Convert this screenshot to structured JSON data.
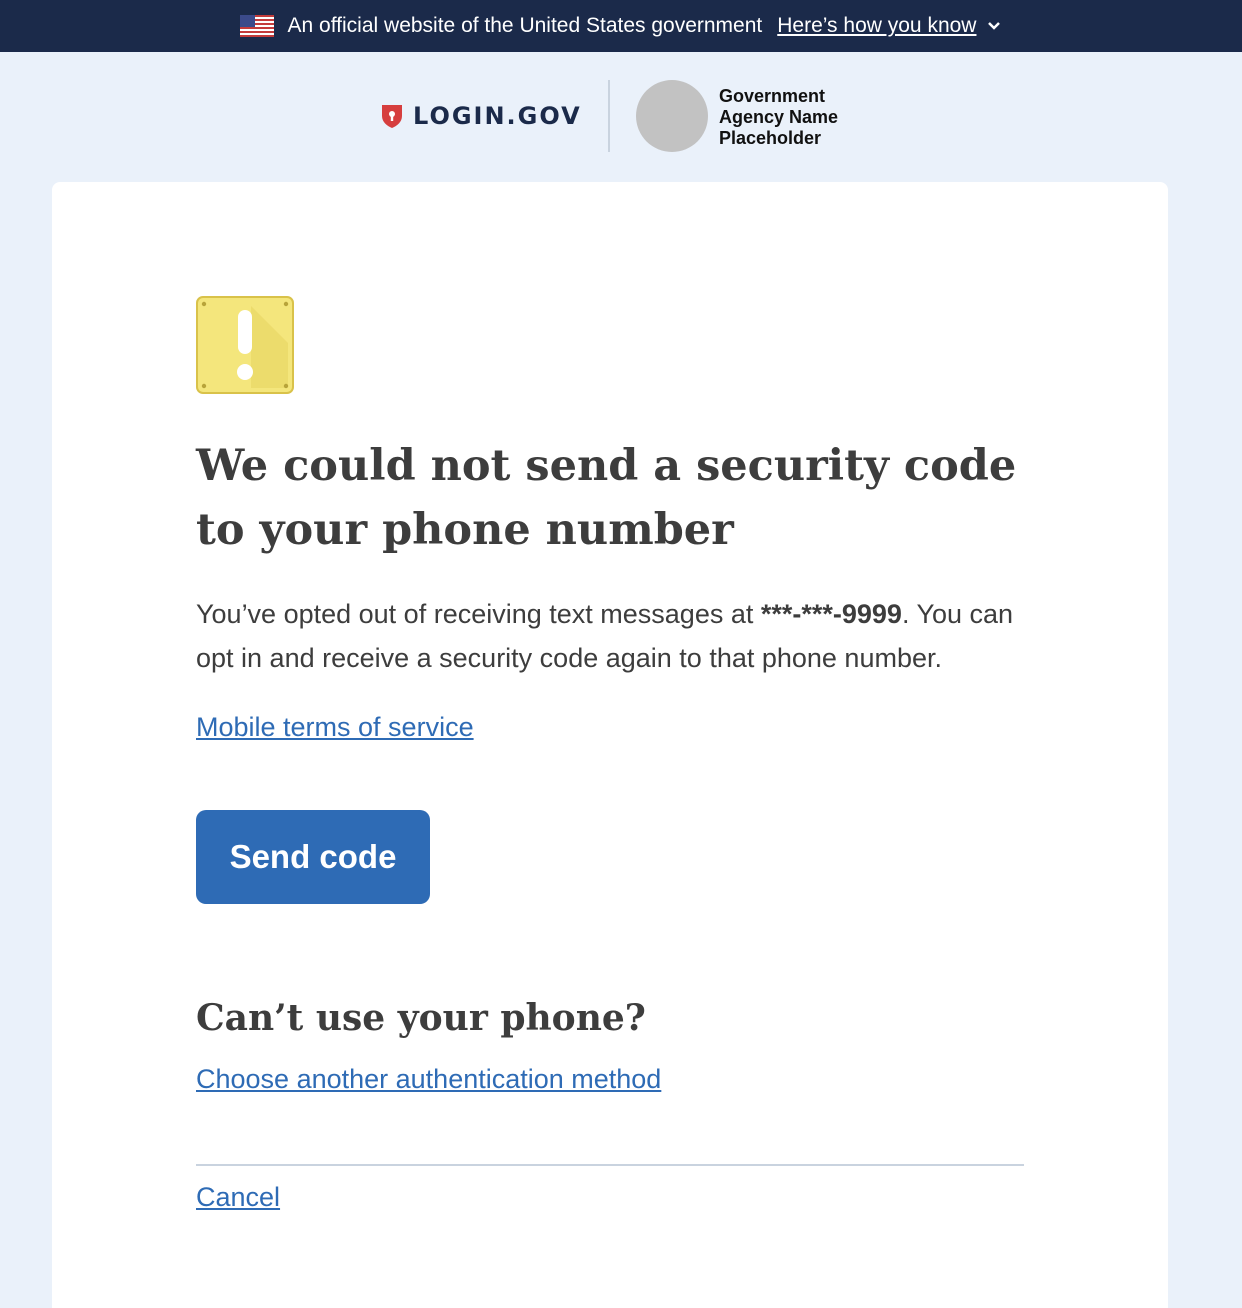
{
  "gov_banner": {
    "text": "An official website of the United States government",
    "link_label": "Here’s how you know"
  },
  "header": {
    "logo_text": "LOGIN.GOV",
    "agency_name": "Government Agency Name Placeholder"
  },
  "main": {
    "heading": "We could not send a security code to your phone number",
    "intro_before": "You’ve opted out of receiving text messages at ",
    "phone_masked": "***-***-9999",
    "intro_after": ". You can opt in and receive a security code again to that phone number.",
    "terms_link": "Mobile terms of service",
    "send_button": "Send code",
    "subheading": "Can’t use your phone?",
    "alt_method_link": "Choose another authentication method",
    "cancel_link": "Cancel"
  },
  "colors": {
    "banner_bg": "#1b2a4a",
    "page_bg": "#eaf1fa",
    "primary": "#2e6bb5",
    "warning": "#f4e67c",
    "shield_red": "#d63e3e"
  },
  "icons": [
    "us-flag-icon",
    "chevron-down-icon",
    "shield-icon",
    "warning-icon"
  ]
}
